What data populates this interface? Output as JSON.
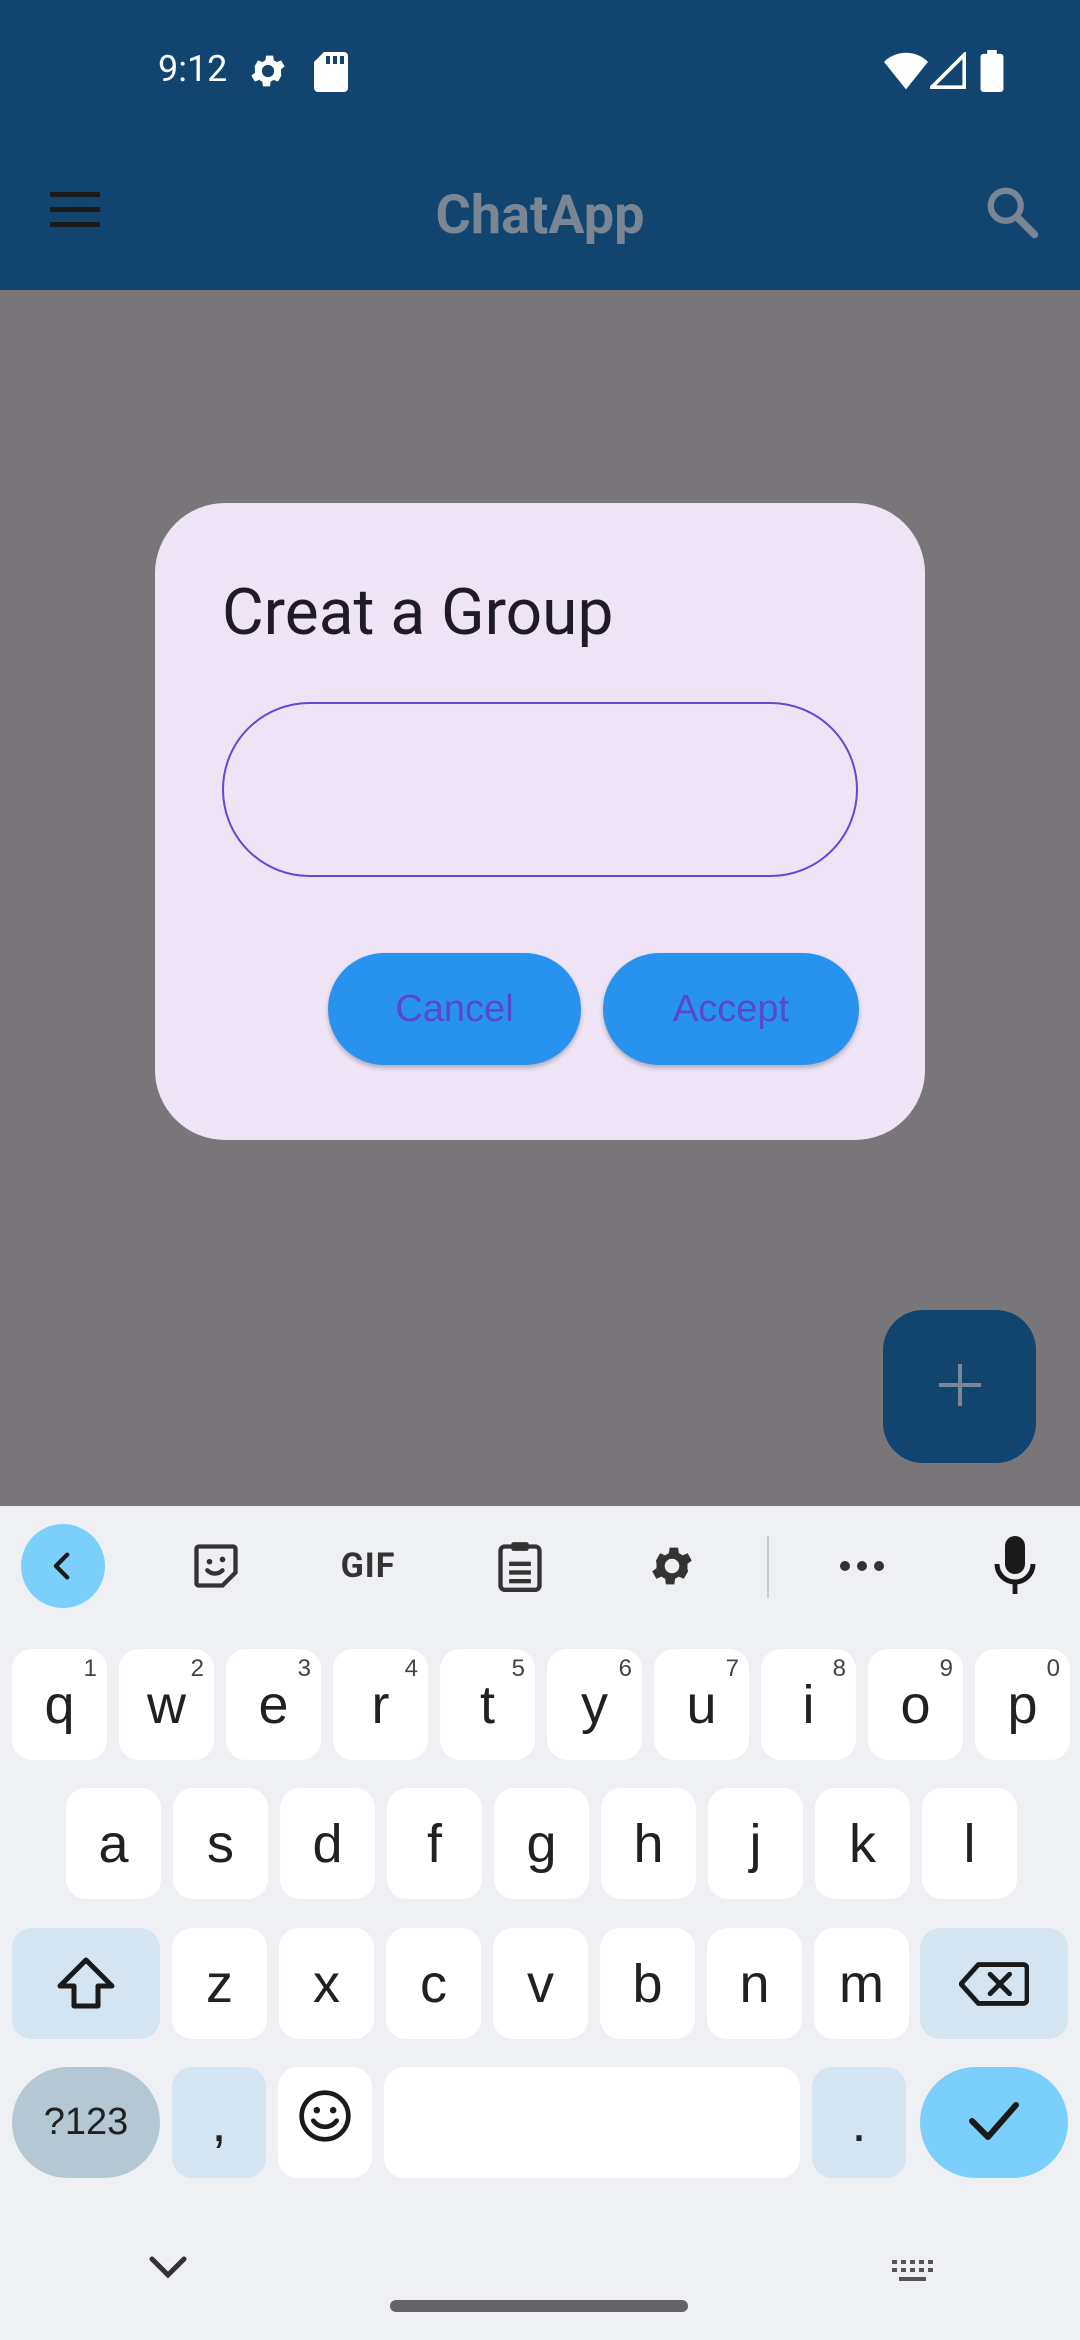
{
  "status_bar": {
    "time": "9:12",
    "icons": [
      "settings-icon",
      "sd-card-icon",
      "wifi-icon",
      "signal-icon",
      "battery-icon"
    ]
  },
  "app_bar": {
    "title": "ChatApp",
    "left_icon": "menu-icon",
    "right_icon": "search-icon"
  },
  "dialog": {
    "title": "Creat a Group",
    "input_value": "",
    "cancel_label": "Cancel",
    "accept_label": "Accept"
  },
  "fab": {
    "icon": "plus-icon"
  },
  "keyboard": {
    "toolbar": [
      "back-icon",
      "sticker-icon",
      "gif-icon",
      "clipboard-icon",
      "settings-icon",
      "more-icon",
      "mic-icon"
    ],
    "gif_label": "GIF",
    "row1": [
      {
        "key": "q",
        "hint": "1"
      },
      {
        "key": "w",
        "hint": "2"
      },
      {
        "key": "e",
        "hint": "3"
      },
      {
        "key": "r",
        "hint": "4"
      },
      {
        "key": "t",
        "hint": "5"
      },
      {
        "key": "y",
        "hint": "6"
      },
      {
        "key": "u",
        "hint": "7"
      },
      {
        "key": "i",
        "hint": "8"
      },
      {
        "key": "o",
        "hint": "9"
      },
      {
        "key": "p",
        "hint": "0"
      }
    ],
    "row2": [
      "a",
      "s",
      "d",
      "f",
      "g",
      "h",
      "j",
      "k",
      "l"
    ],
    "row3": [
      "z",
      "x",
      "c",
      "v",
      "b",
      "n",
      "m"
    ],
    "symbols_label": "?123",
    "comma_label": ",",
    "period_label": "."
  },
  "colors": {
    "primary": "#114570",
    "scrim": "#797679",
    "dialog_bg": "#eee4f6",
    "button_bg": "#2893ef",
    "button_text": "#5a47cf",
    "input_border": "#6845d6",
    "keyboard_accent": "#7bd0fb"
  }
}
